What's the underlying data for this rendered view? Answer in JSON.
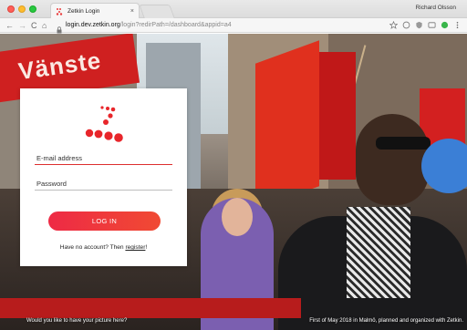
{
  "window": {
    "tab_title": "Zetkin Login",
    "tab_close": "×",
    "profile_name": "Richard Olsson"
  },
  "toolbar": {
    "back": "←",
    "forward": "→",
    "reload": "C",
    "home": "⌂",
    "url_host": "login.dev.zetkin.org",
    "url_path": "/login?redirPath=/dashboard&appid=a4"
  },
  "login": {
    "email_placeholder": "E-mail address",
    "password_placeholder": "Password",
    "login_button": "LOG IN",
    "register_prefix": "Have no account? Then ",
    "register_link": "register",
    "register_suffix": "!"
  },
  "background": {
    "flag_text": "Vänste"
  },
  "captions": {
    "left": "Would you like to have your picture here?",
    "right": "First of May 2018 in Malmö, planned and organized with Zetkin."
  },
  "colors": {
    "brand_red": "#ee2a45",
    "brand_orange": "#f04a33"
  }
}
